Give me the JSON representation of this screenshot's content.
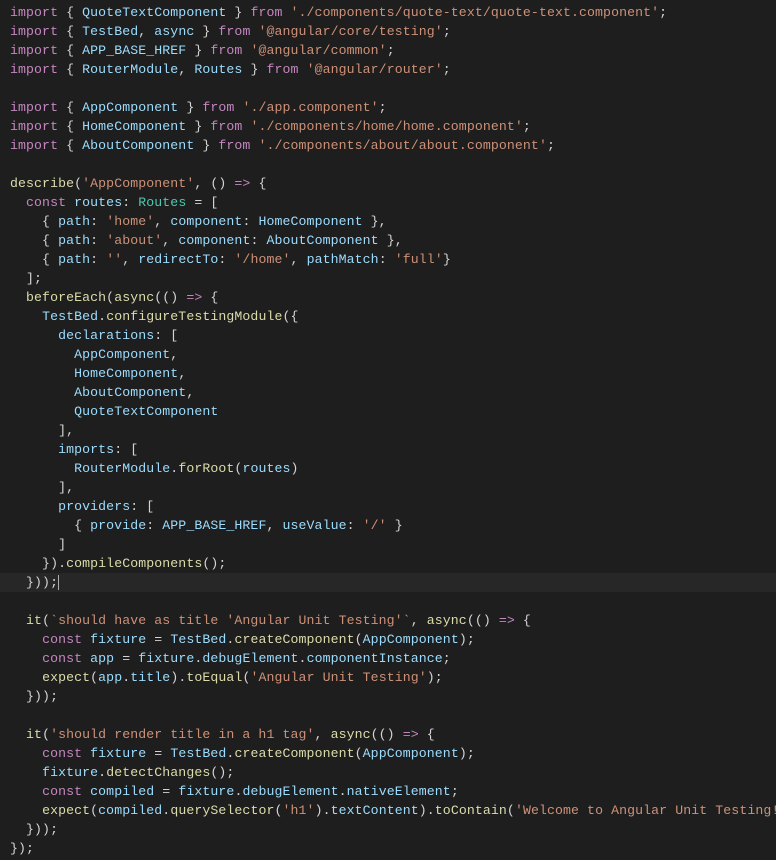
{
  "code_lines": [
    {
      "type": "line",
      "segments": [
        [
          "kw",
          "import"
        ],
        [
          "punc",
          " { "
        ],
        [
          "id",
          "QuoteTextComponent"
        ],
        [
          "punc",
          " } "
        ],
        [
          "flow",
          "from"
        ],
        [
          "punc",
          " "
        ],
        [
          "str",
          "'./components/quote-text/quote-text.component'"
        ],
        [
          "punc",
          ";"
        ]
      ]
    },
    {
      "type": "line",
      "segments": [
        [
          "kw",
          "import"
        ],
        [
          "punc",
          " { "
        ],
        [
          "id",
          "TestBed"
        ],
        [
          "punc",
          ", "
        ],
        [
          "id",
          "async"
        ],
        [
          "punc",
          " } "
        ],
        [
          "flow",
          "from"
        ],
        [
          "punc",
          " "
        ],
        [
          "str",
          "'@angular/core/testing'"
        ],
        [
          "punc",
          ";"
        ]
      ]
    },
    {
      "type": "line",
      "segments": [
        [
          "kw",
          "import"
        ],
        [
          "punc",
          " { "
        ],
        [
          "id",
          "APP_BASE_HREF"
        ],
        [
          "punc",
          " } "
        ],
        [
          "flow",
          "from"
        ],
        [
          "punc",
          " "
        ],
        [
          "str",
          "'@angular/common'"
        ],
        [
          "punc",
          ";"
        ]
      ]
    },
    {
      "type": "line",
      "segments": [
        [
          "kw",
          "import"
        ],
        [
          "punc",
          " { "
        ],
        [
          "id",
          "RouterModule"
        ],
        [
          "punc",
          ", "
        ],
        [
          "id",
          "Routes"
        ],
        [
          "punc",
          " } "
        ],
        [
          "flow",
          "from"
        ],
        [
          "punc",
          " "
        ],
        [
          "str",
          "'@angular/router'"
        ],
        [
          "punc",
          ";"
        ]
      ]
    },
    {
      "type": "blank"
    },
    {
      "type": "line",
      "segments": [
        [
          "kw",
          "import"
        ],
        [
          "punc",
          " { "
        ],
        [
          "id",
          "AppComponent"
        ],
        [
          "punc",
          " } "
        ],
        [
          "flow",
          "from"
        ],
        [
          "punc",
          " "
        ],
        [
          "str",
          "'./app.component'"
        ],
        [
          "punc",
          ";"
        ]
      ]
    },
    {
      "type": "line",
      "segments": [
        [
          "kw",
          "import"
        ],
        [
          "punc",
          " { "
        ],
        [
          "id",
          "HomeComponent"
        ],
        [
          "punc",
          " } "
        ],
        [
          "flow",
          "from"
        ],
        [
          "punc",
          " "
        ],
        [
          "str",
          "'./components/home/home.component'"
        ],
        [
          "punc",
          ";"
        ]
      ]
    },
    {
      "type": "line",
      "segments": [
        [
          "kw",
          "import"
        ],
        [
          "punc",
          " { "
        ],
        [
          "id",
          "AboutComponent"
        ],
        [
          "punc",
          " } "
        ],
        [
          "flow",
          "from"
        ],
        [
          "punc",
          " "
        ],
        [
          "str",
          "'./components/about/about.component'"
        ],
        [
          "punc",
          ";"
        ]
      ]
    },
    {
      "type": "blank"
    },
    {
      "type": "line",
      "segments": [
        [
          "func",
          "describe"
        ],
        [
          "punc",
          "("
        ],
        [
          "str",
          "'AppComponent'"
        ],
        [
          "punc",
          ", () "
        ],
        [
          "kw",
          "=>"
        ],
        [
          "punc",
          " {"
        ]
      ]
    },
    {
      "type": "line",
      "segments": [
        [
          "punc",
          "  "
        ],
        [
          "kw",
          "const"
        ],
        [
          "punc",
          " "
        ],
        [
          "id",
          "routes"
        ],
        [
          "punc",
          ": "
        ],
        [
          "type",
          "Routes"
        ],
        [
          "punc",
          " = ["
        ]
      ]
    },
    {
      "type": "line",
      "segments": [
        [
          "punc",
          "    { "
        ],
        [
          "prop",
          "path"
        ],
        [
          "punc",
          ": "
        ],
        [
          "str",
          "'home'"
        ],
        [
          "punc",
          ", "
        ],
        [
          "prop",
          "component"
        ],
        [
          "punc",
          ": "
        ],
        [
          "id",
          "HomeComponent"
        ],
        [
          "punc",
          " },"
        ]
      ]
    },
    {
      "type": "line",
      "segments": [
        [
          "punc",
          "    { "
        ],
        [
          "prop",
          "path"
        ],
        [
          "punc",
          ": "
        ],
        [
          "str",
          "'about'"
        ],
        [
          "punc",
          ", "
        ],
        [
          "prop",
          "component"
        ],
        [
          "punc",
          ": "
        ],
        [
          "id",
          "AboutComponent"
        ],
        [
          "punc",
          " },"
        ]
      ]
    },
    {
      "type": "line",
      "segments": [
        [
          "punc",
          "    { "
        ],
        [
          "prop",
          "path"
        ],
        [
          "punc",
          ": "
        ],
        [
          "str",
          "''"
        ],
        [
          "punc",
          ", "
        ],
        [
          "prop",
          "redirectTo"
        ],
        [
          "punc",
          ": "
        ],
        [
          "str",
          "'/home'"
        ],
        [
          "punc",
          ", "
        ],
        [
          "prop",
          "pathMatch"
        ],
        [
          "punc",
          ": "
        ],
        [
          "str",
          "'full'"
        ],
        [
          "punc",
          "}"
        ]
      ]
    },
    {
      "type": "line",
      "segments": [
        [
          "punc",
          "  ];"
        ]
      ]
    },
    {
      "type": "line",
      "segments": [
        [
          "punc",
          "  "
        ],
        [
          "func",
          "beforeEach"
        ],
        [
          "punc",
          "("
        ],
        [
          "func",
          "async"
        ],
        [
          "punc",
          "(() "
        ],
        [
          "kw",
          "=>"
        ],
        [
          "punc",
          " {"
        ]
      ]
    },
    {
      "type": "line",
      "segments": [
        [
          "punc",
          "    "
        ],
        [
          "id",
          "TestBed"
        ],
        [
          "punc",
          "."
        ],
        [
          "func",
          "configureTestingModule"
        ],
        [
          "punc",
          "({"
        ]
      ]
    },
    {
      "type": "line",
      "segments": [
        [
          "punc",
          "      "
        ],
        [
          "prop",
          "declarations"
        ],
        [
          "punc",
          ": ["
        ]
      ]
    },
    {
      "type": "line",
      "segments": [
        [
          "punc",
          "        "
        ],
        [
          "id",
          "AppComponent"
        ],
        [
          "punc",
          ","
        ]
      ]
    },
    {
      "type": "line",
      "segments": [
        [
          "punc",
          "        "
        ],
        [
          "id",
          "HomeComponent"
        ],
        [
          "punc",
          ","
        ]
      ]
    },
    {
      "type": "line",
      "segments": [
        [
          "punc",
          "        "
        ],
        [
          "id",
          "AboutComponent"
        ],
        [
          "punc",
          ","
        ]
      ]
    },
    {
      "type": "line",
      "segments": [
        [
          "punc",
          "        "
        ],
        [
          "id",
          "QuoteTextComponent"
        ]
      ]
    },
    {
      "type": "line",
      "segments": [
        [
          "punc",
          "      ],"
        ]
      ]
    },
    {
      "type": "line",
      "segments": [
        [
          "punc",
          "      "
        ],
        [
          "prop",
          "imports"
        ],
        [
          "punc",
          ": ["
        ]
      ]
    },
    {
      "type": "line",
      "segments": [
        [
          "punc",
          "        "
        ],
        [
          "id",
          "RouterModule"
        ],
        [
          "punc",
          "."
        ],
        [
          "func",
          "forRoot"
        ],
        [
          "punc",
          "("
        ],
        [
          "id",
          "routes"
        ],
        [
          "punc",
          ")"
        ]
      ]
    },
    {
      "type": "line",
      "segments": [
        [
          "punc",
          "      ],"
        ]
      ]
    },
    {
      "type": "line",
      "segments": [
        [
          "punc",
          "      "
        ],
        [
          "prop",
          "providers"
        ],
        [
          "punc",
          ": ["
        ]
      ]
    },
    {
      "type": "line",
      "segments": [
        [
          "punc",
          "        { "
        ],
        [
          "prop",
          "provide"
        ],
        [
          "punc",
          ": "
        ],
        [
          "id",
          "APP_BASE_HREF"
        ],
        [
          "punc",
          ", "
        ],
        [
          "prop",
          "useValue"
        ],
        [
          "punc",
          ": "
        ],
        [
          "str",
          "'/'"
        ],
        [
          "punc",
          " }"
        ]
      ]
    },
    {
      "type": "line",
      "segments": [
        [
          "punc",
          "      ]"
        ]
      ]
    },
    {
      "type": "line",
      "segments": [
        [
          "punc",
          "    })."
        ],
        [
          "func",
          "compileComponents"
        ],
        [
          "punc",
          "();"
        ]
      ]
    },
    {
      "type": "cursor",
      "segments": [
        [
          "punc",
          "  }));"
        ]
      ],
      "cursor_after": true
    },
    {
      "type": "blank"
    },
    {
      "type": "line",
      "segments": [
        [
          "punc",
          "  "
        ],
        [
          "func",
          "it"
        ],
        [
          "punc",
          "("
        ],
        [
          "str",
          "`should have as title 'Angular Unit Testing'`"
        ],
        [
          "punc",
          ", "
        ],
        [
          "func",
          "async"
        ],
        [
          "punc",
          "(() "
        ],
        [
          "kw",
          "=>"
        ],
        [
          "punc",
          " {"
        ]
      ]
    },
    {
      "type": "line",
      "segments": [
        [
          "punc",
          "    "
        ],
        [
          "kw",
          "const"
        ],
        [
          "punc",
          " "
        ],
        [
          "id",
          "fixture"
        ],
        [
          "punc",
          " = "
        ],
        [
          "id",
          "TestBed"
        ],
        [
          "punc",
          "."
        ],
        [
          "func",
          "createComponent"
        ],
        [
          "punc",
          "("
        ],
        [
          "id",
          "AppComponent"
        ],
        [
          "punc",
          ");"
        ]
      ]
    },
    {
      "type": "line",
      "segments": [
        [
          "punc",
          "    "
        ],
        [
          "kw",
          "const"
        ],
        [
          "punc",
          " "
        ],
        [
          "id",
          "app"
        ],
        [
          "punc",
          " = "
        ],
        [
          "id",
          "fixture"
        ],
        [
          "punc",
          "."
        ],
        [
          "id",
          "debugElement"
        ],
        [
          "punc",
          "."
        ],
        [
          "id",
          "componentInstance"
        ],
        [
          "punc",
          ";"
        ]
      ]
    },
    {
      "type": "line",
      "segments": [
        [
          "punc",
          "    "
        ],
        [
          "func",
          "expect"
        ],
        [
          "punc",
          "("
        ],
        [
          "id",
          "app"
        ],
        [
          "punc",
          "."
        ],
        [
          "id",
          "title"
        ],
        [
          "punc",
          ")."
        ],
        [
          "func",
          "toEqual"
        ],
        [
          "punc",
          "("
        ],
        [
          "str",
          "'Angular Unit Testing'"
        ],
        [
          "punc",
          ");"
        ]
      ]
    },
    {
      "type": "line",
      "segments": [
        [
          "punc",
          "  }));"
        ]
      ]
    },
    {
      "type": "blank"
    },
    {
      "type": "line",
      "segments": [
        [
          "punc",
          "  "
        ],
        [
          "func",
          "it"
        ],
        [
          "punc",
          "("
        ],
        [
          "str",
          "'should render title in a h1 tag'"
        ],
        [
          "punc",
          ", "
        ],
        [
          "func",
          "async"
        ],
        [
          "punc",
          "(() "
        ],
        [
          "kw",
          "=>"
        ],
        [
          "punc",
          " {"
        ]
      ]
    },
    {
      "type": "line",
      "segments": [
        [
          "punc",
          "    "
        ],
        [
          "kw",
          "const"
        ],
        [
          "punc",
          " "
        ],
        [
          "id",
          "fixture"
        ],
        [
          "punc",
          " = "
        ],
        [
          "id",
          "TestBed"
        ],
        [
          "punc",
          "."
        ],
        [
          "func",
          "createComponent"
        ],
        [
          "punc",
          "("
        ],
        [
          "id",
          "AppComponent"
        ],
        [
          "punc",
          ");"
        ]
      ]
    },
    {
      "type": "line",
      "segments": [
        [
          "punc",
          "    "
        ],
        [
          "id",
          "fixture"
        ],
        [
          "punc",
          "."
        ],
        [
          "func",
          "detectChanges"
        ],
        [
          "punc",
          "();"
        ]
      ]
    },
    {
      "type": "line",
      "segments": [
        [
          "punc",
          "    "
        ],
        [
          "kw",
          "const"
        ],
        [
          "punc",
          " "
        ],
        [
          "id",
          "compiled"
        ],
        [
          "punc",
          " = "
        ],
        [
          "id",
          "fixture"
        ],
        [
          "punc",
          "."
        ],
        [
          "id",
          "debugElement"
        ],
        [
          "punc",
          "."
        ],
        [
          "id",
          "nativeElement"
        ],
        [
          "punc",
          ";"
        ]
      ]
    },
    {
      "type": "line",
      "segments": [
        [
          "punc",
          "    "
        ],
        [
          "func",
          "expect"
        ],
        [
          "punc",
          "("
        ],
        [
          "id",
          "compiled"
        ],
        [
          "punc",
          "."
        ],
        [
          "func",
          "querySelector"
        ],
        [
          "punc",
          "("
        ],
        [
          "str",
          "'h1'"
        ],
        [
          "punc",
          ")."
        ],
        [
          "id",
          "textContent"
        ],
        [
          "punc",
          ")."
        ],
        [
          "func",
          "toContain"
        ],
        [
          "punc",
          "("
        ],
        [
          "str",
          "'Welcome to Angular Unit Testing!'"
        ],
        [
          "punc",
          ");"
        ]
      ]
    },
    {
      "type": "line",
      "segments": [
        [
          "punc",
          "  }));"
        ]
      ]
    },
    {
      "type": "line",
      "segments": [
        [
          "punc",
          "});"
        ]
      ]
    }
  ]
}
